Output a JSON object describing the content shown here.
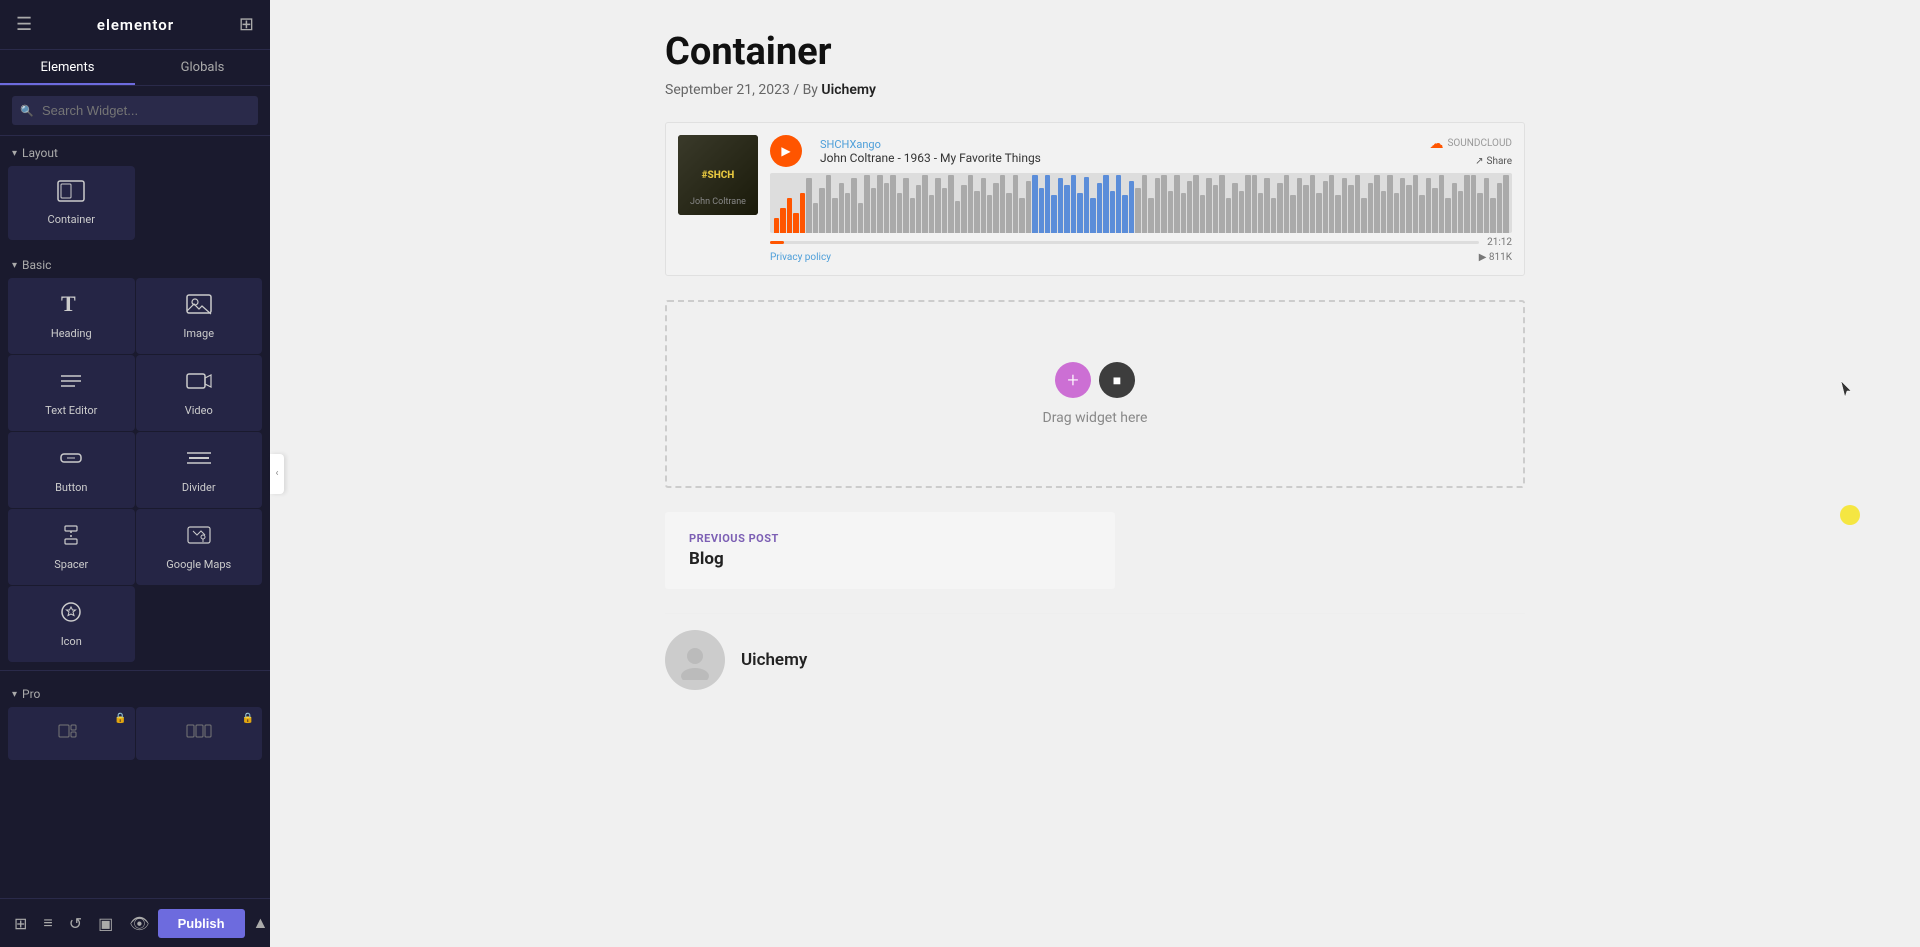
{
  "app": {
    "name": "elementor",
    "logo": "elementor"
  },
  "sidebar": {
    "tabs": [
      {
        "id": "elements",
        "label": "Elements",
        "active": true
      },
      {
        "id": "globals",
        "label": "Globals",
        "active": false
      }
    ],
    "search": {
      "placeholder": "Search Widget..."
    },
    "sections": [
      {
        "id": "layout",
        "label": "Layout",
        "widgets": [
          {
            "id": "container",
            "label": "Container",
            "icon": "⬜"
          }
        ]
      },
      {
        "id": "basic",
        "label": "Basic",
        "widgets": [
          {
            "id": "heading",
            "label": "Heading",
            "icon": "T"
          },
          {
            "id": "image",
            "label": "Image",
            "icon": "🖼"
          },
          {
            "id": "text-editor",
            "label": "Text Editor",
            "icon": "≡"
          },
          {
            "id": "video",
            "label": "Video",
            "icon": "▶"
          },
          {
            "id": "button",
            "label": "Button",
            "icon": "⬡"
          },
          {
            "id": "divider",
            "label": "Divider",
            "icon": "⊟"
          },
          {
            "id": "spacer",
            "label": "Spacer",
            "icon": "↕"
          },
          {
            "id": "google-maps",
            "label": "Google Maps",
            "icon": "📍"
          },
          {
            "id": "icon",
            "label": "Icon",
            "icon": "✦"
          }
        ]
      },
      {
        "id": "pro",
        "label": "Pro",
        "widgets": []
      }
    ],
    "bottom_actions": [
      {
        "id": "structure",
        "icon": "⊞"
      },
      {
        "id": "history",
        "icon": "↺"
      },
      {
        "id": "responsive",
        "icon": "▣"
      },
      {
        "id": "preview",
        "icon": "👁"
      }
    ],
    "publish_label": "Publish",
    "chevron_up": "▲"
  },
  "content": {
    "post_title": "Container",
    "post_date": "September 21, 2023",
    "post_by": "By",
    "post_author": "Uichemy",
    "soundcloud": {
      "artist": "SHCHXango",
      "track": "John Coltrane - 1963 - My Favorite Things",
      "brand": "SOUNDCLOUD",
      "share_label": "Share",
      "privacy_policy": "Privacy policy",
      "duration": "21:12",
      "plays": "811K"
    },
    "dropzone": {
      "label": "Drag widget here",
      "add_icon": "+",
      "square_icon": "■"
    },
    "prev_nav": {
      "label": "PREVIOUS POST",
      "title": "Blog"
    },
    "author": {
      "name": "Uichemy"
    }
  },
  "colors": {
    "accent_purple": "#6d6bde",
    "soundcloud_orange": "#ff5500",
    "nav_purple": "#7c5fb4",
    "drop_purple": "#cc6fd4",
    "cursor_yellow": "#f5e642"
  }
}
